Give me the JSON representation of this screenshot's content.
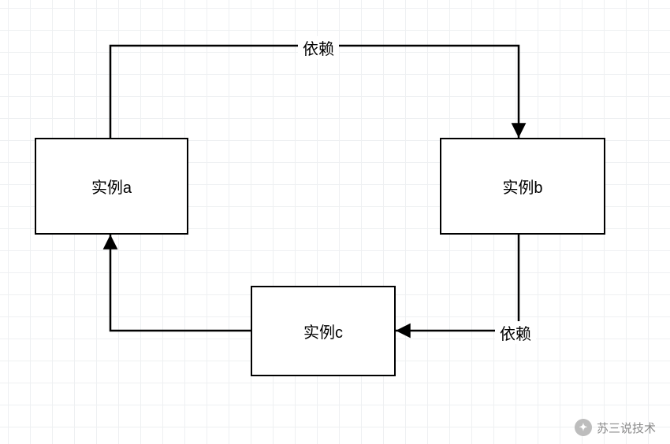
{
  "nodes": {
    "a": {
      "label": "实例a"
    },
    "b": {
      "label": "实例b"
    },
    "c": {
      "label": "实例c"
    }
  },
  "edges": {
    "a_to_b": {
      "label": "依赖"
    },
    "b_to_c": {
      "label": "依赖"
    }
  },
  "watermark": {
    "text": "苏三说技术"
  }
}
